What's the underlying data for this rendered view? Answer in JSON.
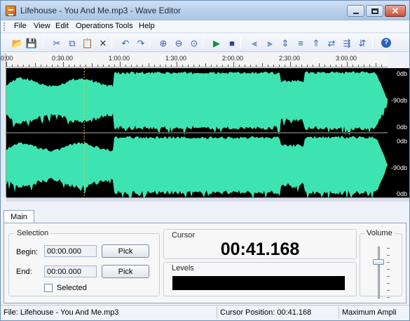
{
  "window": {
    "title": "Lifehouse - You And Me.mp3 - Wave Editor"
  },
  "menu": [
    "File",
    "View",
    "Edit",
    "Operations",
    "Tools",
    "Help"
  ],
  "toolbar": [
    {
      "icon": "open-folder-icon",
      "glyph": "📂"
    },
    {
      "icon": "save-icon",
      "glyph": "💾"
    },
    {
      "icon": "cut-icon",
      "glyph": "✂"
    },
    {
      "icon": "copy-icon",
      "glyph": "⧉"
    },
    {
      "icon": "paste-icon",
      "glyph": "📋"
    },
    {
      "icon": "delete-icon",
      "glyph": "✕"
    },
    {
      "icon": "undo-icon",
      "glyph": "↶"
    },
    {
      "icon": "redo-icon",
      "glyph": "↷"
    },
    {
      "icon": "zoom-in-icon",
      "glyph": "⊕"
    },
    {
      "icon": "zoom-out-icon",
      "glyph": "⊖"
    },
    {
      "icon": "zoom-fit-icon",
      "glyph": "⊙"
    },
    {
      "icon": "play-icon",
      "glyph": "▶"
    },
    {
      "icon": "stop-icon",
      "glyph": "■"
    },
    {
      "icon": "fade-in-icon",
      "glyph": "⫷"
    },
    {
      "icon": "fade-out-icon",
      "glyph": "⫸"
    },
    {
      "icon": "normalize-icon",
      "glyph": "⇕"
    },
    {
      "icon": "silence-icon",
      "glyph": "≡"
    },
    {
      "icon": "amplify-icon",
      "glyph": "⇑"
    },
    {
      "icon": "reverse-icon",
      "glyph": "⇄"
    },
    {
      "icon": "effect-icon",
      "glyph": "⇶"
    },
    {
      "icon": "effect-2-icon",
      "glyph": "⇵"
    },
    {
      "icon": "help-icon",
      "glyph": "?"
    }
  ],
  "timeline": {
    "labels": [
      "0:00",
      "0:30.00",
      "1:00.00",
      "1:30.00",
      "2:00.00",
      "2:30.00",
      "3:00.00"
    ],
    "db_labels": [
      "0db",
      "-90db",
      "0db",
      "0db",
      "-90db",
      "0db"
    ]
  },
  "colors": {
    "waveform": "#3de3b0",
    "background": "#000000",
    "cursor": "#e0d040"
  },
  "tabs": [
    "Main"
  ],
  "selection": {
    "title": "Selection",
    "begin_label": "Begin:",
    "begin_value": "00:00.000",
    "end_label": "End:",
    "end_value": "00:00.000",
    "pick_label": "Pick",
    "selected_label": "Selected",
    "selected_checked": false
  },
  "cursor": {
    "title": "Cursor",
    "time": "00:41.168"
  },
  "levels": {
    "title": "Levels"
  },
  "volume": {
    "title": "Volume",
    "level": 0.72
  },
  "status": {
    "file": "File: Lifehouse - You And Me.mp3",
    "cursor_position": "Cursor Position: 00:41.168",
    "amplitude": "Maximum Ampli"
  }
}
